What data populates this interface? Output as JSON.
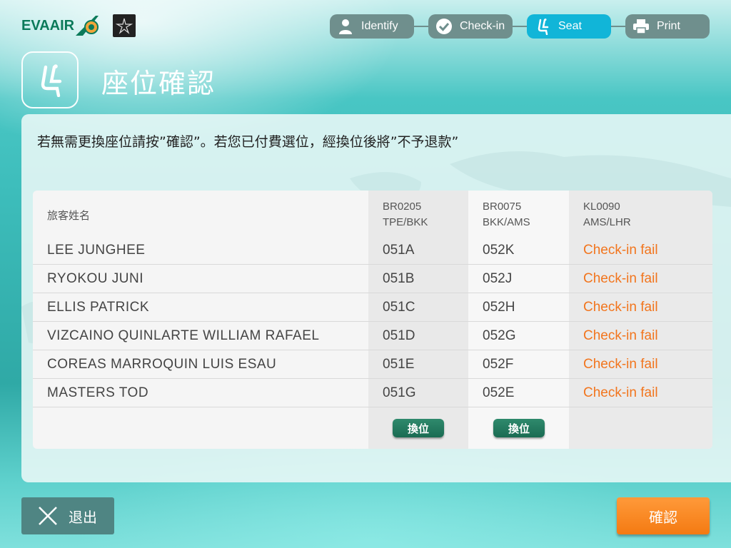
{
  "header": {
    "brand": "EVAAIR",
    "steps": [
      {
        "label": "Identify",
        "icon": "person-icon",
        "active": false
      },
      {
        "label": "Check-in",
        "icon": "checkmark-icon",
        "active": false
      },
      {
        "label": "Seat",
        "icon": "seat-icon",
        "active": true
      },
      {
        "label": "Print",
        "icon": "printer-icon",
        "active": false
      }
    ]
  },
  "page": {
    "title": "座位確認",
    "instruction": "若無需更換座位請按”確認”。若您已付費選位，經換位後將”不予退款”"
  },
  "table": {
    "name_header": "旅客姓名",
    "flights": [
      {
        "flight": "BR0205",
        "route": "TPE/BKK"
      },
      {
        "flight": "BR0075",
        "route": "BKK/AMS"
      },
      {
        "flight": "KL0090",
        "route": "AMS/LHR"
      }
    ],
    "rows": [
      {
        "name": "LEE JUNGHEE",
        "seat1": "051A",
        "seat2": "052K",
        "status": "Check-in fail"
      },
      {
        "name": "RYOKOU JUNI",
        "seat1": "051B",
        "seat2": "052J",
        "status": "Check-in fail"
      },
      {
        "name": "ELLIS PATRICK",
        "seat1": "051C",
        "seat2": "052H",
        "status": "Check-in fail"
      },
      {
        "name": "VIZCAINO QUINLARTE WILLIAM RAFAEL",
        "seat1": "051D",
        "seat2": "052G",
        "status": "Check-in fail"
      },
      {
        "name": "COREAS MARROQUIN LUIS ESAU",
        "seat1": "051E",
        "seat2": "052F",
        "status": "Check-in fail"
      },
      {
        "name": "MASTERS TOD",
        "seat1": "051G",
        "seat2": "052E",
        "status": "Check-in fail"
      }
    ],
    "swap_label": "換位"
  },
  "footer": {
    "exit_label": "退出",
    "confirm_label": "確認"
  },
  "colors": {
    "active_step": "#11b5d8",
    "inactive_step": "#6f8f8d",
    "fail_text": "#f2751d",
    "confirm": "#f47a12",
    "swap": "#1a6b52"
  }
}
